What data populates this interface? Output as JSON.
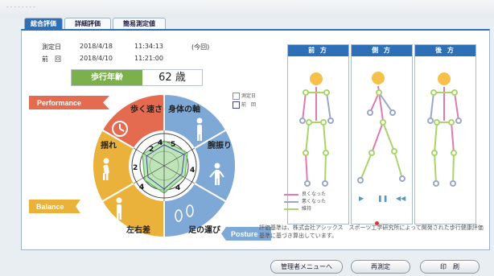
{
  "window": {
    "title": "- - - - - - - -"
  },
  "tabs": [
    {
      "label": "総合評価"
    },
    {
      "label": "詳細評価"
    },
    {
      "label": "簡易測定値"
    }
  ],
  "measurement": {
    "current_label": "測定日",
    "current_date": "2018/4/18",
    "current_time": "11:34:13",
    "current_note": "(今回)",
    "previous_label": "前　回",
    "previous_date": "2018/4/10",
    "previous_time": "11:21:00"
  },
  "walking_age": {
    "label": "歩行年齢",
    "value": "62 歳"
  },
  "radar_legend": {
    "current": "測定日",
    "previous": "前　回"
  },
  "categories": {
    "performance": "Performance",
    "balance": "Balance",
    "posture": "Posture"
  },
  "segments": [
    {
      "label": "歩く速さ",
      "icon": "stopwatch-icon"
    },
    {
      "label": "身体の軸",
      "icon": "standing-person-icon"
    },
    {
      "label": "腕振り",
      "icon": "arm-swing-icon"
    },
    {
      "label": "足の運び",
      "icon": "footprints-icon"
    },
    {
      "label": "左右差",
      "icon": "standing-person-icon"
    },
    {
      "label": "揺れ",
      "icon": "swaying-person-icon"
    }
  ],
  "radar_ticks": {
    "inner": "2",
    "mid": "4",
    "outer": "5",
    "left_a": "2",
    "left_b": "4",
    "bottom_a": "4",
    "bottom_b": "4"
  },
  "posture_views": {
    "front": "前 方",
    "side": "側 方",
    "back": "後 方"
  },
  "posture_legend": [
    {
      "label": "良くなった",
      "color": "#e07ab0"
    },
    {
      "label": "悪くなった",
      "color": "#9aa7c9"
    },
    {
      "label": "維持",
      "color": "#a8d46a"
    }
  ],
  "playback_icons": [
    "play-icon",
    "pause-icon",
    "rewind-icon"
  ],
  "note": "評価基準は、株式会社アシックス　スポーツ工学研究所によって開発された歩行健康評価基準に基づき算出しています。",
  "buttons": {
    "admin_menu": "管理者メニューへ",
    "remeasure": "再測定",
    "print": "印　刷"
  },
  "colors": {
    "accent": "#2f6fb5",
    "performance": "#e46b4f",
    "balance": "#eab23a",
    "posture": "#7ea8d6",
    "age_label": "#7cb04b"
  }
}
